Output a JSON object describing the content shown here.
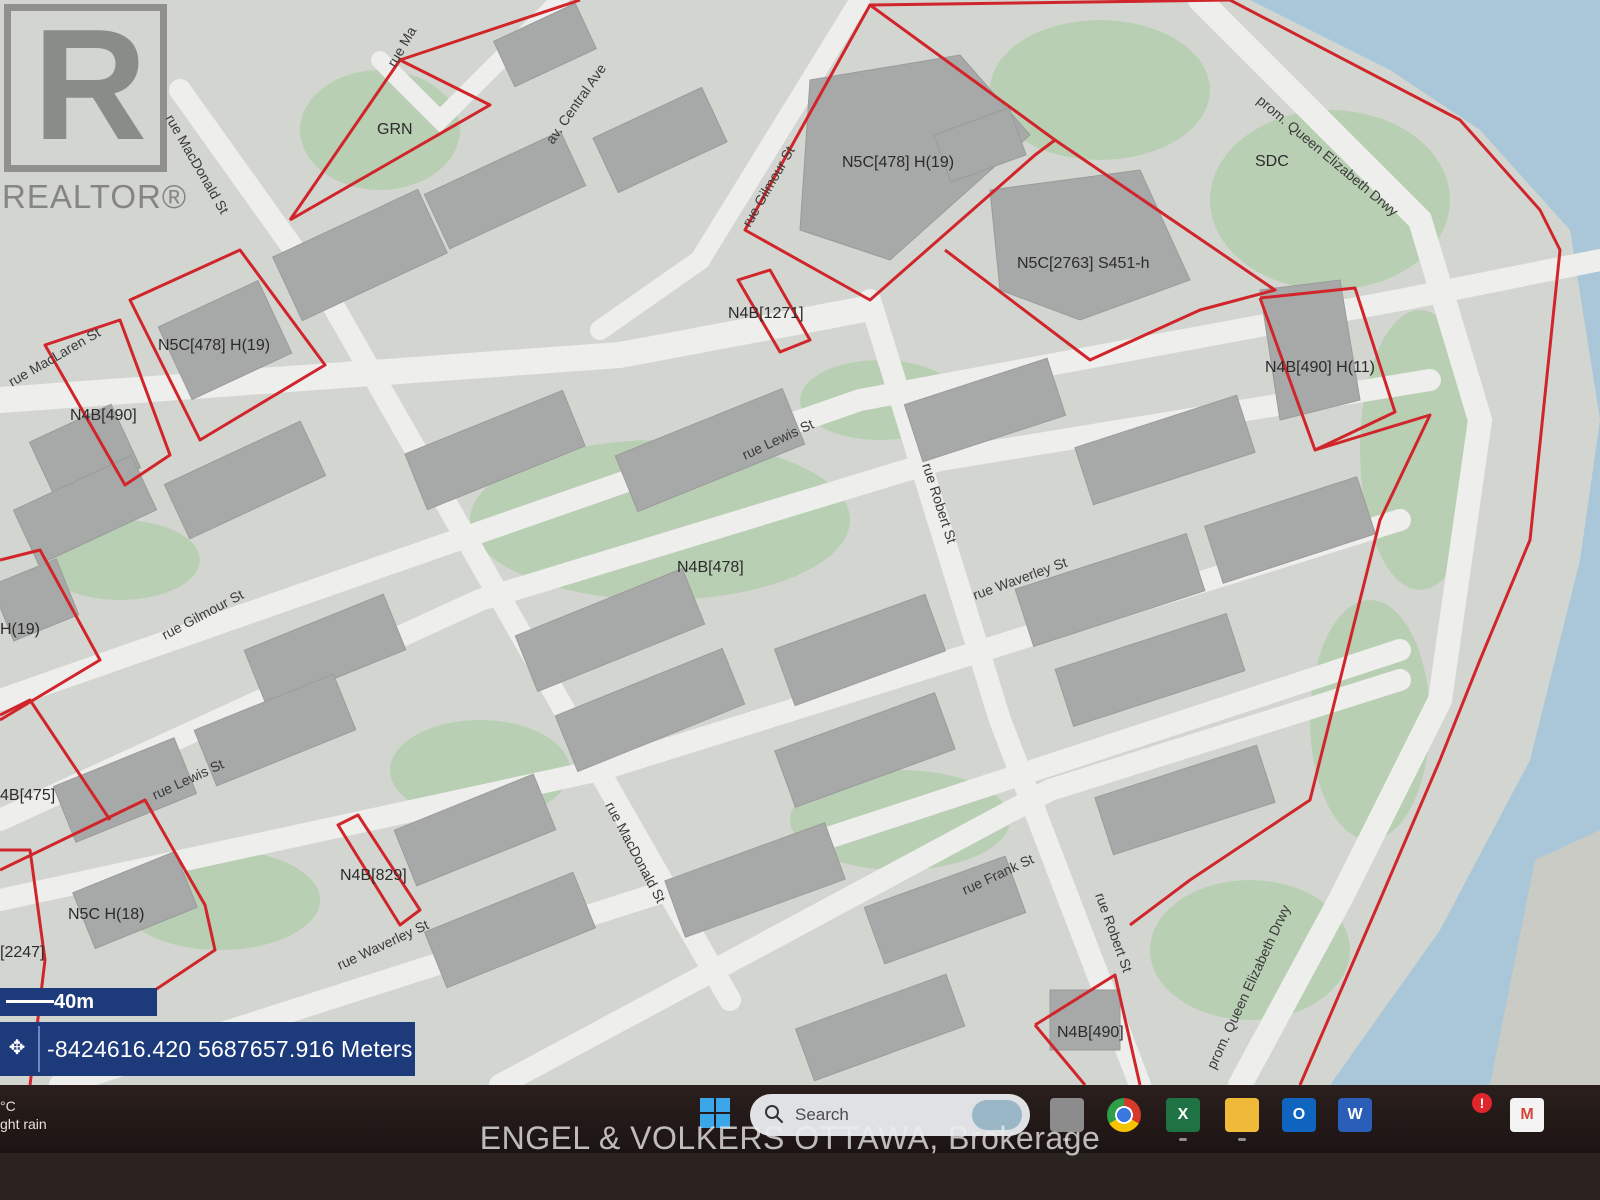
{
  "map": {
    "zones": [
      "GRN",
      "N5C[478] H(19)",
      "SDC",
      "N5C[2763] S451-h",
      "N4B[1271]",
      "N5C[478] H(19)",
      "N4B[490] H(11)",
      "N4B[490]",
      "N4B[478]",
      "H(19)",
      "4B[475]",
      "N4B[829]",
      "N5C H(18)",
      "[2247]",
      "N4B[490]"
    ],
    "streets": [
      "rue MacDonald St",
      "rue Ma",
      "av. Central Ave",
      "rue Gilmour St",
      "prom. Queen Elizabeth Drwy",
      "rue MacLaren St",
      "rue Lewis St",
      "rue Robert St",
      "rue Waverley St",
      "rue Gilmour St",
      "rue Lewis St",
      "rue MacDonald St",
      "rue Frank St",
      "rue Waverley St",
      "rue Robert St",
      "prom. Queen Elizabeth Drwy"
    ],
    "colors": {
      "zone_line": "#d0262b",
      "water": "#a9c7d8",
      "buildings": "#a7a8a8",
      "trees": "#b9cfb3",
      "ground": "#d3d6d0"
    }
  },
  "scale": {
    "label": "40m"
  },
  "coordinates": {
    "text": "-8424616.420 5687657.916 Meters"
  },
  "weather": {
    "temp": "°C",
    "condition": "ght rain"
  },
  "taskbar": {
    "search_placeholder": "Search",
    "excel_letter": "X",
    "outlook_letter": "O",
    "word_letter": "W",
    "gmail_letter": "M",
    "notification": "!"
  },
  "watermark": {
    "text": "ENGEL & VOLKERS OTTAWA, Brokerage"
  },
  "logo": {
    "text": "REALTOR®",
    "letter": "R"
  }
}
